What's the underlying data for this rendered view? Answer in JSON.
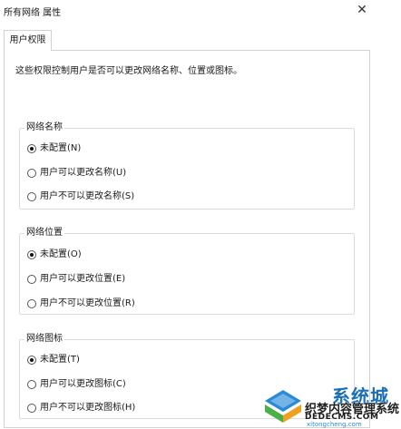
{
  "window": {
    "title": "所有网络 属性",
    "close_glyph": "✕"
  },
  "tab": {
    "label": "用户权限"
  },
  "description": "这些权限控制用户是否可以更改网络名称、位置或图标。",
  "groups": [
    {
      "label": "网络名称",
      "options": [
        {
          "label": "未配置(N)",
          "selected": true
        },
        {
          "label": "用户可以更改名称(U)",
          "selected": false
        },
        {
          "label": "用户不可以更改名称(S)",
          "selected": false
        }
      ]
    },
    {
      "label": "网络位置",
      "options": [
        {
          "label": "未配置(O)",
          "selected": true
        },
        {
          "label": "用户可以更改位置(E)",
          "selected": false
        },
        {
          "label": "用户不可以更改位置(R)",
          "selected": false
        }
      ]
    },
    {
      "label": "网络图标",
      "options": [
        {
          "label": "未配置(T)",
          "selected": true
        },
        {
          "label": "用户可以更改图标(C)",
          "selected": false
        },
        {
          "label": "用户不可以更改图标(H)",
          "selected": false
        }
      ]
    }
  ],
  "watermark": {
    "brand": "系统城",
    "chinese": "织梦内容管理系统",
    "url": "DEDECMS.COM",
    "url2": "xitongcheng.com"
  }
}
